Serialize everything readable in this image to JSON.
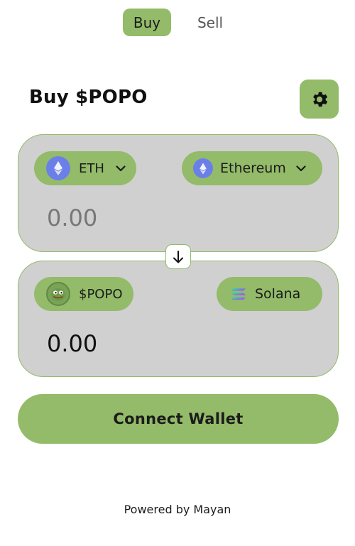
{
  "tabs": {
    "buy": "Buy",
    "sell": "Sell"
  },
  "title": "Buy $POPO",
  "from": {
    "token": "ETH",
    "network": "Ethereum",
    "amount": "0.00",
    "token_icon": "ethereum-icon",
    "network_icon": "ethereum-icon"
  },
  "to": {
    "token": "$POPO",
    "network": "Solana",
    "amount": "0.00",
    "token_icon": "popo-icon",
    "network_icon": "solana-icon"
  },
  "connect_label": "Connect Wallet",
  "footer": "Powered by Mayan",
  "colors": {
    "accent": "#93bb69",
    "card_bg": "#d0d0d0",
    "eth_blue": "#6b7fe8"
  }
}
